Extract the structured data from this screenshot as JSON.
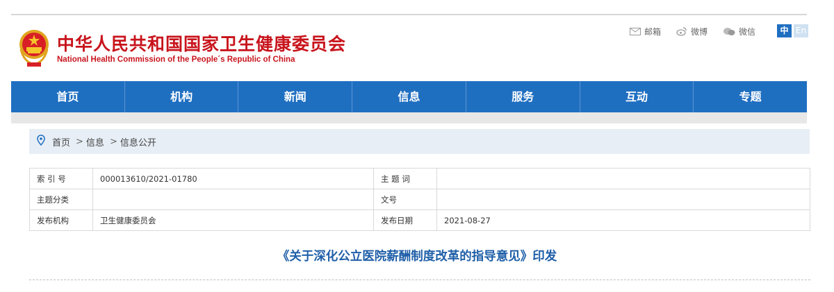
{
  "header": {
    "title": "中华人民共和国国家卫生健康委员会",
    "subtitle": "National Health Commission of the People´s Republic of China",
    "links": [
      {
        "icon": "mail-icon",
        "label": "邮箱"
      },
      {
        "icon": "weibo-icon",
        "label": "微博"
      },
      {
        "icon": "wechat-icon",
        "label": "微信"
      }
    ],
    "lang_zh": "中",
    "lang_en": "En"
  },
  "nav": {
    "items": [
      "首页",
      "机构",
      "新闻",
      "信息",
      "服务",
      "互动",
      "专题"
    ]
  },
  "breadcrumb": {
    "items": [
      "首页",
      "信息",
      "信息公开"
    ],
    "separator": ">"
  },
  "meta": {
    "rows": [
      {
        "k1": "索 引 号",
        "v1": "000013610/2021-01780",
        "k2": "主 题 词",
        "v2": ""
      },
      {
        "k1": "主题分类",
        "v1": "",
        "k2": "文号",
        "v2": ""
      },
      {
        "k1": "发布机构",
        "v1": "卫生健康委员会",
        "k2": "发布日期",
        "v2": "2021-08-27"
      }
    ]
  },
  "article": {
    "title": "《关于深化公立医院薪酬制度改革的指导意见》印发"
  },
  "colors": {
    "brand_red": "#c8141c",
    "nav_blue": "#1f6fc1",
    "title_blue": "#1f5fa8"
  }
}
